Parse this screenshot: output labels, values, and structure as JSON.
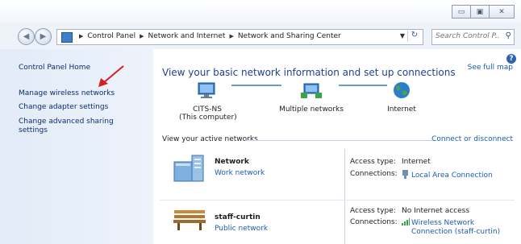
{
  "window": {
    "caption": {
      "minimize": "▭",
      "maximize": "▣",
      "close": "✕"
    }
  },
  "address": {
    "breadcrumbs": [
      "Control Panel",
      "Network and Internet",
      "Network and Sharing Center"
    ],
    "search_placeholder": "Search Control P..."
  },
  "sidebar": {
    "items": [
      "Control Panel Home",
      "Manage wireless networks",
      "Change adapter settings",
      "Change advanced sharing settings"
    ]
  },
  "main": {
    "heading": "View your basic network information and set up connections",
    "see_full_map": "See full map",
    "map": {
      "computer_name": "CITS-NS",
      "computer_sub": "(This computer)",
      "middle": "Multiple networks",
      "internet": "Internet"
    },
    "active_title": "View your active networks",
    "connect_link": "Connect or disconnect",
    "networks": [
      {
        "name": "Network",
        "category": "Work network",
        "access_label": "Access type:",
        "access_value": "Internet",
        "connections_label": "Connections:",
        "connection": "Local Area Connection"
      },
      {
        "name": "staff-curtin",
        "category": "Public network",
        "access_label": "Access type:",
        "access_value": "No Internet access",
        "connections_label": "Connections:",
        "connection_line1": "Wireless Network",
        "connection_line2": "Connection (staff-curtin)"
      }
    ]
  },
  "colors": {
    "link": "#1c5bb4",
    "heading": "#1f3f8e",
    "sidebar_link": "#0a2d6e",
    "annotation_arrow": "#d32020"
  }
}
